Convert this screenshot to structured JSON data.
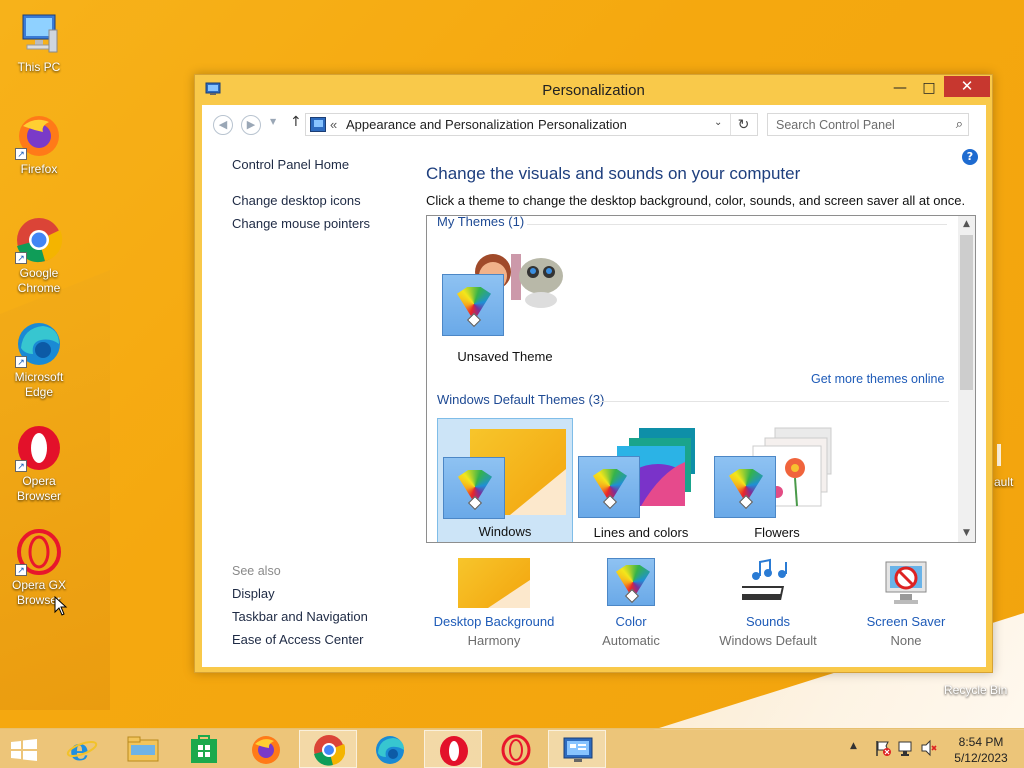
{
  "desktop": {
    "icons": [
      {
        "label": "This PC",
        "icon": "computer-icon"
      },
      {
        "label": "Firefox",
        "icon": "firefox-icon"
      },
      {
        "label": "Google Chrome",
        "icon": "chrome-icon"
      },
      {
        "label": "Microsoft Edge",
        "icon": "edge-icon"
      },
      {
        "label": "Opera Browser",
        "icon": "opera-icon"
      },
      {
        "label": "Opera GX Browser",
        "icon": "opera-gx-icon"
      }
    ],
    "recycle_bin_label": "Recycle Bin",
    "partial_label": "ault"
  },
  "window": {
    "title": "Personalization",
    "controls": {
      "minimize": "—",
      "maximize": "□",
      "close": "✕"
    },
    "address": {
      "prefix": "«",
      "crumbs": [
        "Appearance and Personalization",
        "Personalization"
      ],
      "separator": "›"
    },
    "search_placeholder": "Search Control Panel",
    "help": "?"
  },
  "left_pane": {
    "links": [
      "Control Panel Home",
      "Change desktop icons",
      "Change mouse pointers"
    ],
    "see_also_label": "See also",
    "see_also": [
      "Display",
      "Taskbar and Navigation",
      "Ease of Access Center"
    ]
  },
  "main": {
    "heading": "Change the visuals and sounds on your computer",
    "subheading": "Click a theme to change the desktop background, color, sounds, and screen saver all at once.",
    "my_themes_label": "My Themes (1)",
    "my_themes": [
      {
        "name": "Unsaved Theme"
      }
    ],
    "get_more_link": "Get more themes online",
    "default_themes_label": "Windows Default Themes (3)",
    "default_themes": [
      {
        "name": "Windows",
        "selected": true
      },
      {
        "name": "Lines and colors",
        "selected": false
      },
      {
        "name": "Flowers",
        "selected": false
      }
    ]
  },
  "settings": [
    {
      "label": "Desktop Background",
      "value": "Harmony",
      "icon": "desktop-background-icon"
    },
    {
      "label": "Color",
      "value": "Automatic",
      "icon": "color-icon"
    },
    {
      "label": "Sounds",
      "value": "Windows Default",
      "icon": "sounds-icon"
    },
    {
      "label": "Screen Saver",
      "value": "None",
      "icon": "screen-saver-icon"
    }
  ],
  "taskbar": {
    "time": "8:54 PM",
    "date": "5/12/2023"
  }
}
